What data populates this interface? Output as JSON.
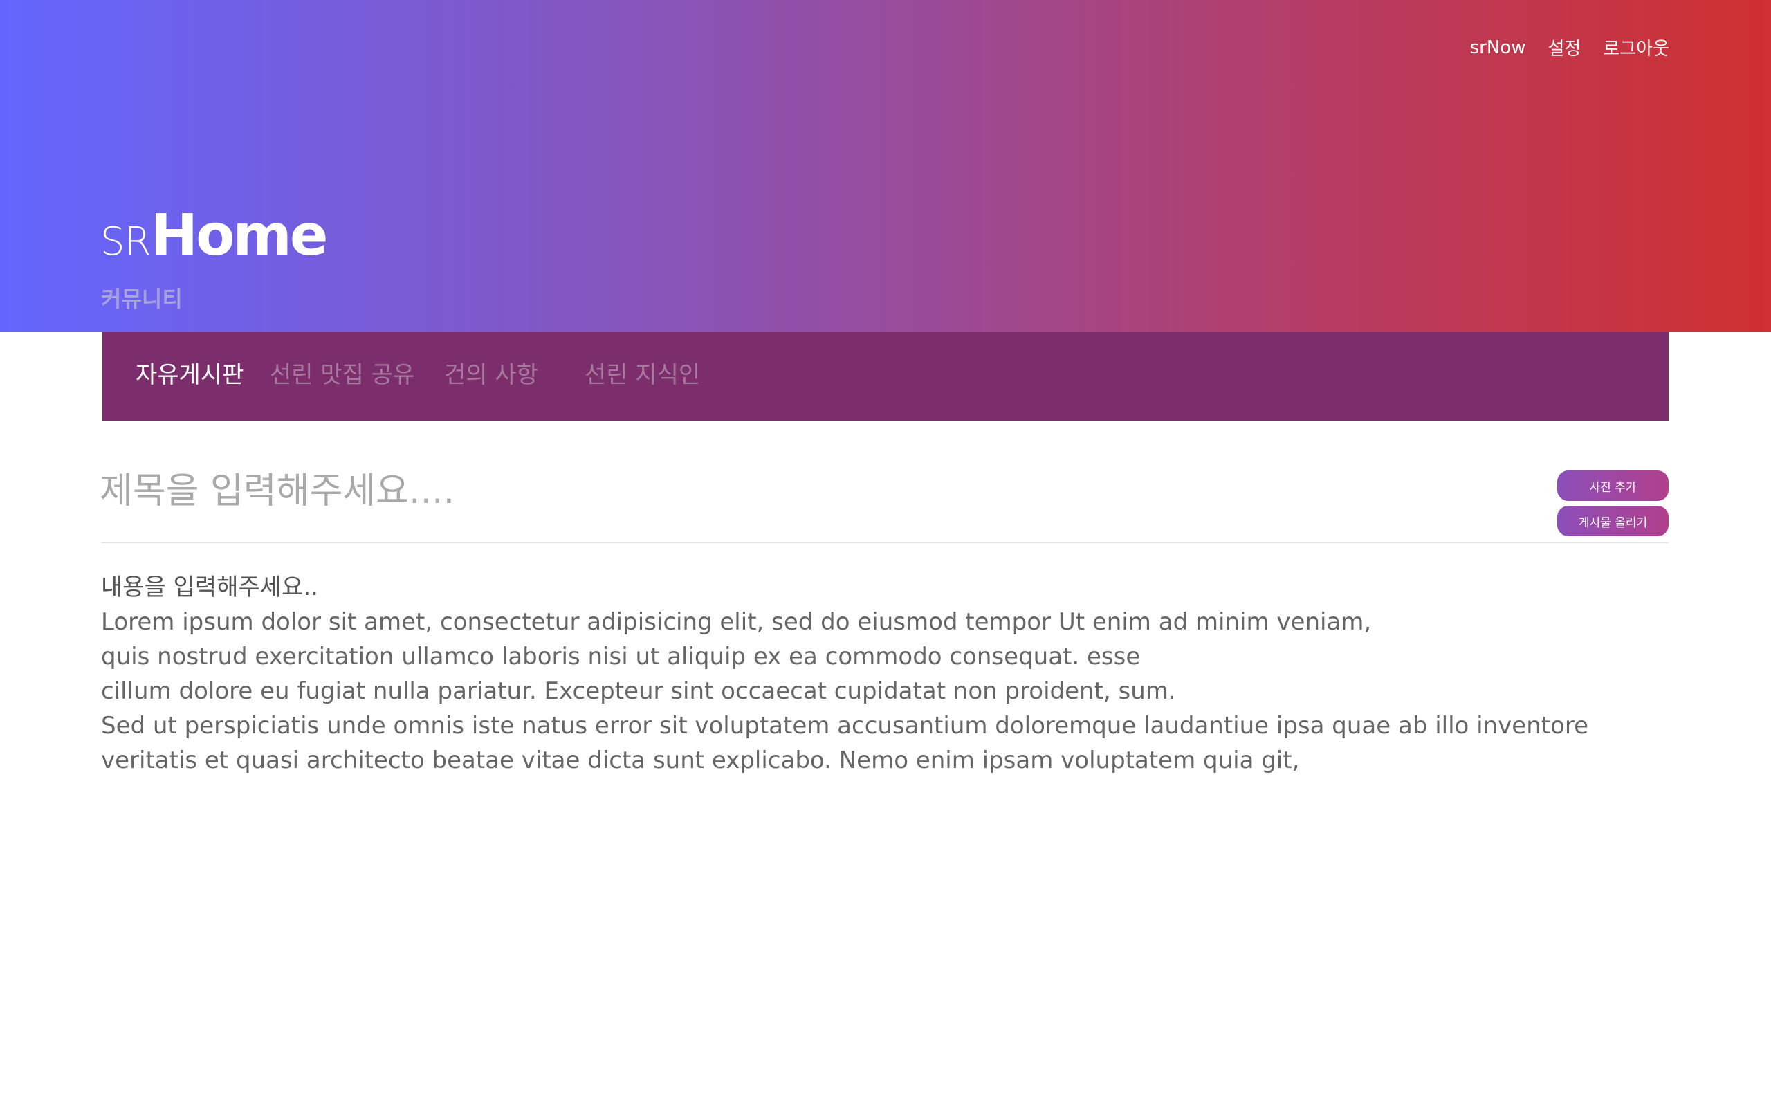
{
  "header": {
    "brand_prefix": "SR",
    "brand_main": "Home",
    "subtitle": "커뮤니티",
    "nav": [
      "srNow",
      "설정",
      "로그아웃"
    ]
  },
  "categories": [
    {
      "label": "자유게시판",
      "active": true
    },
    {
      "label": "선린 맛집 공유",
      "active": false
    },
    {
      "label": "건의 사항",
      "active": false
    },
    {
      "label": "선린 지식인",
      "active": false
    }
  ],
  "editor": {
    "title_placeholder": "제목을 입력해주세요....",
    "add_photo_label": "사진 추가",
    "submit_label": "게시물 올리기",
    "content_placeholder": "내용을 입력해주세요..",
    "content_lines": [
      "Lorem ipsum dolor sit amet, consectetur adipisicing elit, sed do eiusmod tempor  Ut enim ad minim veniam,",
      "quis nostrud exercitation ullamco laboris nisi ut aliquip ex ea commodo consequat. esse",
      "cillum dolore eu fugiat nulla pariatur. Excepteur sint occaecat cupidatat non proident, sum.",
      "Sed ut perspiciatis unde omnis iste natus error sit voluptatem accusantium doloremque laudantiue ipsa quae ab illo inventore",
      "veritatis et quasi architecto beatae vitae dicta sunt explicabo. Nemo enim ipsam voluptatem quia git,"
    ]
  },
  "colors": {
    "gradient_start": "#6366fe",
    "gradient_end": "#cf3030",
    "category_bar": "#7c2d6c",
    "button_gradient_start": "#8c4fba",
    "button_gradient_end": "#b13f8c"
  }
}
